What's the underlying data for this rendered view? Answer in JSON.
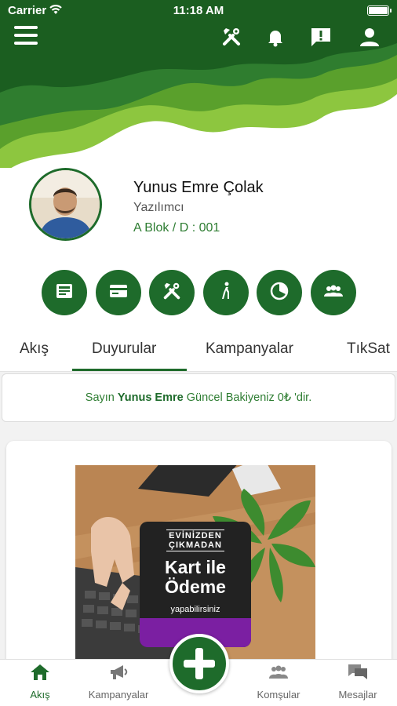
{
  "status_bar": {
    "carrier": "Carrier",
    "time": "11:18 AM"
  },
  "top_bar": {
    "icons": [
      "menu-icon",
      "tools-icon",
      "bell-icon",
      "feedback-icon",
      "user-icon"
    ]
  },
  "colors": {
    "primary": "#1e6b2b",
    "accent_light": "#7cc242",
    "text_green": "#2e7d32"
  },
  "profile": {
    "name": "Yunus Emre Çolak",
    "role": "Yazılımcı",
    "unit": "A Blok / D : 001"
  },
  "quick_actions": [
    "news-icon",
    "card-icon",
    "tools-icon",
    "walk-icon",
    "pie-chart-icon",
    "group-icon"
  ],
  "tabs": [
    {
      "label": "Akış"
    },
    {
      "label": "Duyurular"
    },
    {
      "label": "Kampanyalar"
    },
    {
      "label": "TıkSat"
    }
  ],
  "balance": {
    "prefix": "Sayın ",
    "name": "Yunus Emre",
    "suffix": " Güncel Bakiyeniz 0₺ 'dir."
  },
  "promo": {
    "line1": "EVİNİZDEN",
    "line2": "ÇIKMADAN",
    "title1": "Kart ile",
    "title2": "Ödeme",
    "subtitle": "yapabilirsiniz"
  },
  "bottom_nav": [
    {
      "label": "Akış",
      "icon": "home-icon"
    },
    {
      "label": "Kampanyalar",
      "icon": "megaphone-icon"
    },
    {
      "label": "Komşular",
      "icon": "neighbors-icon"
    },
    {
      "label": "Mesajlar",
      "icon": "messages-icon"
    }
  ]
}
